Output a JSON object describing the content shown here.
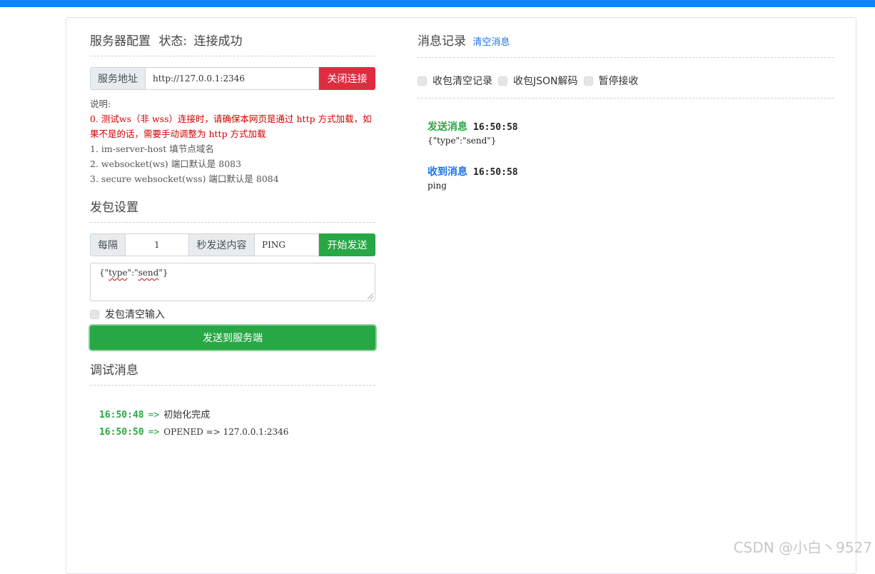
{
  "server_config": {
    "title": "服务器配置",
    "status_label": "状态:",
    "status_value": "连接成功",
    "address_label": "服务地址",
    "address_value": "http://127.0.0.1:2346",
    "close_button": "关闭连接",
    "notes_title": "说明:",
    "notes_warning": "0. 测试ws（非 wss）连接时，请确保本网页是通过 http 方式加载，如果不是的话，需要手动调整为 http 方式加载",
    "notes": [
      "1. im-server-host 填节点域名",
      "2. websocket(ws) 端口默认是 8083",
      "3. secure websocket(wss) 端口默认是 8084"
    ]
  },
  "send_settings": {
    "title": "发包设置",
    "every_label": "每隔",
    "interval_value": "1",
    "seconds_label": "秒发送内容",
    "content_value": "PING",
    "start_button": "开始发送",
    "payload_prefix": "{\"",
    "payload_key": "type",
    "payload_mid": "\":\"",
    "payload_val": "send",
    "payload_suffix": "\"}",
    "clear_input_label": "发包清空输入",
    "send_button": "发送到服务端"
  },
  "debug": {
    "title": "调试消息",
    "arrow": "=>",
    "lines": [
      {
        "time": "16:50:48",
        "text": "初始化完成"
      },
      {
        "time": "16:50:50",
        "text": "OPENED => 127.0.0.1:2346"
      }
    ]
  },
  "messages": {
    "title": "消息记录",
    "clear_link": "清空消息",
    "options": [
      "收包清空记录",
      "收包JSON解码",
      "暂停接收"
    ],
    "items": [
      {
        "label": "发送消息",
        "time": "16:50:58",
        "body": "{\"type\":\"send\"}",
        "color": "#28a745"
      },
      {
        "label": "收到消息",
        "time": "16:50:58",
        "body": "ping",
        "color": "#1a73e8"
      }
    ]
  },
  "watermark": "CSDN @小白丶9527",
  "colors": {
    "top_bar": "#0a84ff",
    "danger": "#e02c41",
    "success": "#28a745",
    "link": "#1a73e8",
    "warning_text": "#d30000"
  }
}
